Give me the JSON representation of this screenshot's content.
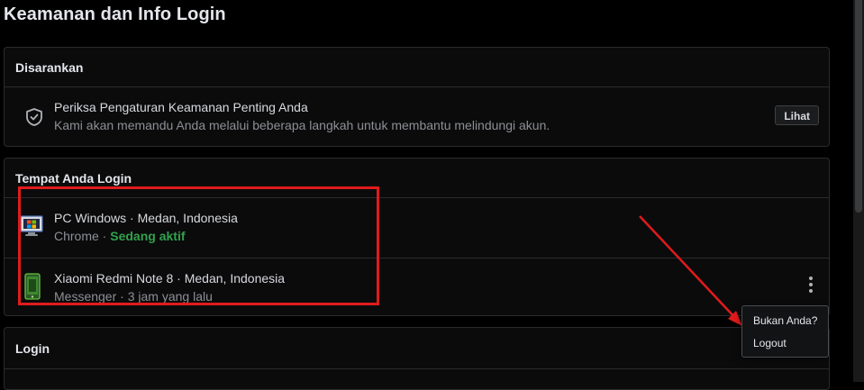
{
  "page": {
    "title": "Keamanan dan Info Login"
  },
  "recommended": {
    "header": "Disarankan",
    "item": {
      "icon": "shield-check-icon",
      "title": "Periksa Pengaturan Keamanan Penting Anda",
      "subtitle": "Kami akan memandu Anda melalui beberapa langkah untuk membantu melindungi akun.",
      "button": "Lihat"
    }
  },
  "logins": {
    "header": "Tempat Anda Login",
    "devices": [
      {
        "icon": "desktop-windows-icon",
        "device": "PC Windows",
        "separator": " · ",
        "location": "Medan, Indonesia",
        "app": "Chrome",
        "status_separator": " · ",
        "status": "Sedang aktif"
      },
      {
        "icon": "smartphone-icon",
        "device": "Xiaomi Redmi Note 8",
        "separator": " · ",
        "location": "Medan, Indonesia",
        "app": "Messenger",
        "status_separator": " · ",
        "status": "3 jam yang lalu"
      }
    ]
  },
  "login_section": {
    "header": "Login"
  },
  "context_menu": {
    "items": [
      "Bukan Anda?",
      "Logout"
    ]
  },
  "colors": {
    "background": "#000000",
    "card": "#0b0b0c",
    "active_status": "#31a24c",
    "annotation_red": "#e01b1b"
  }
}
